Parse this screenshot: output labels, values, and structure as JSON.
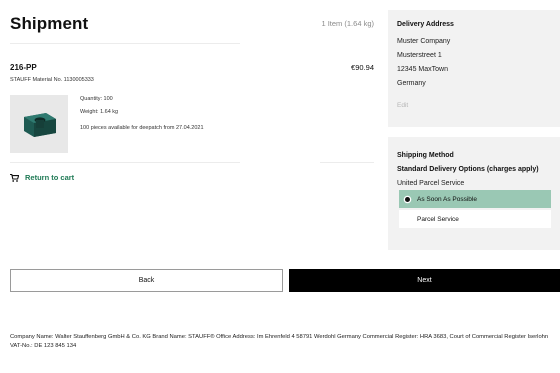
{
  "page": {
    "title": "Shipment",
    "items_count": "1 Item (1.64 kg)"
  },
  "item": {
    "sku": "216-PP",
    "material": "STAUFF Material No. 1130005333",
    "price": "€90.94",
    "quantity": "Quantity: 100",
    "weight": "Weight: 1.64 kg",
    "availability": "100 pieces available for deepatch from 27.04.2021"
  },
  "return_link": {
    "label": "Return to cart",
    "icon": "cart-icon"
  },
  "delivery_address": {
    "title": "Delivery Address",
    "lines": [
      "Muster Company",
      "Musterstreet 1",
      "12345 MaxTown",
      "Germany"
    ],
    "edit": "Edit"
  },
  "shipping": {
    "title": "Shipping Method",
    "options_title": "Standard Delivery Options (charges apply)",
    "carrier": "United Parcel Service",
    "options": [
      {
        "label": "As Soon As Possible",
        "selected": true
      },
      {
        "label": "Parcel Service",
        "selected": false
      }
    ]
  },
  "buttons": {
    "back": "Back",
    "next": "Next"
  },
  "footer": {
    "text": "Company Name: Walter Stauffenberg GmbH & Co. KG Brand Name: STAUFF® Office Address: Im Ehrenfeld 4 58791 Werdohl Germany Commercial Register: HRA 3683, Court of Commercial Register Iserlohn VAT-No.: DE 123 845 134"
  },
  "colors": {
    "accent": "#1f7a55",
    "selected_option_bg": "#9ac8b4",
    "panel_bg": "#f2f2f2",
    "primary_button": "#000000"
  }
}
